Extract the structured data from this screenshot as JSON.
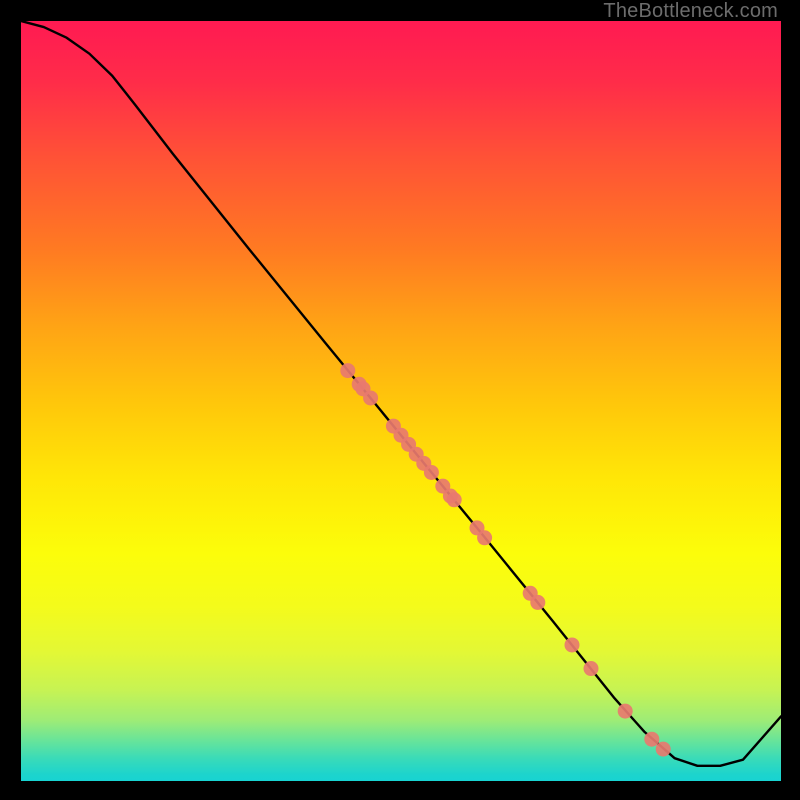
{
  "watermark": "TheBottleneck.com",
  "chart_data": {
    "type": "line",
    "title": "",
    "xlabel": "",
    "ylabel": "",
    "xlim": [
      0,
      100
    ],
    "ylim": [
      0,
      100
    ],
    "grid": false,
    "curve_color": "#000000",
    "point_color": "#e87a6f",
    "series": [
      {
        "name": "curve",
        "x": [
          0,
          3,
          6,
          9,
          12,
          15,
          20,
          30,
          40,
          50,
          60,
          70,
          78,
          82,
          86,
          89,
          92,
          95,
          100
        ],
        "y": [
          100,
          99.2,
          97.8,
          95.7,
          92.8,
          89.0,
          82.5,
          70.0,
          57.7,
          45.5,
          33.3,
          21.0,
          11.0,
          6.5,
          3.0,
          2.0,
          2.0,
          2.8,
          8.5
        ]
      }
    ],
    "points": {
      "name": "markers",
      "x": [
        43,
        44.5,
        45,
        46,
        49,
        50,
        51,
        52,
        53,
        54,
        55.5,
        56.5,
        57,
        60,
        61,
        67,
        68,
        72.5,
        75,
        79.5,
        83,
        84.5
      ],
      "y": [
        54,
        52.2,
        51.6,
        50.4,
        46.7,
        45.5,
        44.3,
        43.0,
        41.8,
        40.6,
        38.8,
        37.5,
        37.0,
        33.3,
        32.0,
        24.7,
        23.5,
        17.9,
        14.8,
        9.2,
        5.5,
        4.2
      ]
    }
  }
}
